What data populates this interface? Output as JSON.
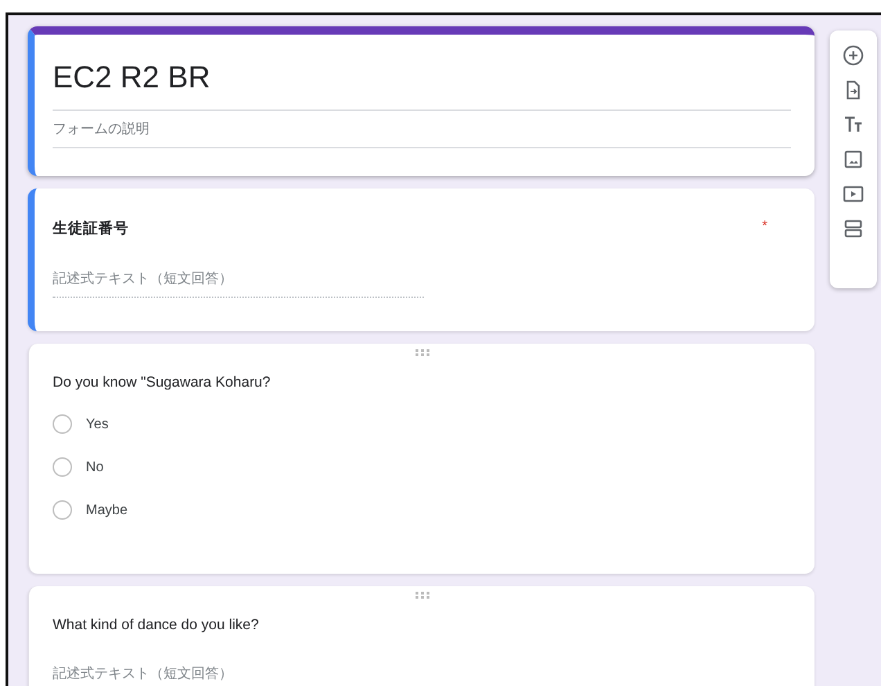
{
  "form": {
    "title": "EC2 R2 BR",
    "description_placeholder": "フォームの説明"
  },
  "required_marker": "*",
  "questions": [
    {
      "kind": "short_text",
      "title": "生徒証番号",
      "required": true,
      "selected": true,
      "placeholder": "記述式テキスト（短文回答）"
    },
    {
      "kind": "multiple_choice",
      "title": "Do you know \"Sugawara Koharu?",
      "required": false,
      "selected": false,
      "options": [
        {
          "label": "Yes",
          "selected": false
        },
        {
          "label": "No",
          "selected": false
        },
        {
          "label": "Maybe",
          "selected": false
        }
      ]
    },
    {
      "kind": "short_text",
      "title": "What kind of dance do you like?",
      "required": false,
      "selected": false,
      "placeholder": "記述式テキスト（短文回答）"
    }
  ]
}
